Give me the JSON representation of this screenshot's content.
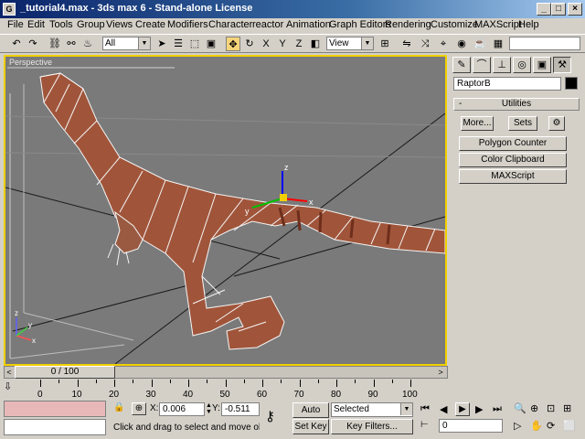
{
  "window": {
    "title": "_tutorial4.max - 3ds max 6 - Stand-alone License",
    "icon_label": "G",
    "controls": [
      "minimize-icon",
      "maximize-icon",
      "close-icon"
    ]
  },
  "menu": [
    "File",
    "Edit",
    "Tools",
    "Group",
    "Views",
    "Create",
    "Modifiers",
    "Character",
    "reactor",
    "Animation",
    "Graph Editors",
    "Rendering",
    "Customize",
    "MAXScript",
    "Help"
  ],
  "toolbar": {
    "selection_filter": "All",
    "reference_coord": "View",
    "axis_labels": [
      "X",
      "Y",
      "Z",
      "XY"
    ]
  },
  "viewport": {
    "label": "Perspective",
    "gizmo_axes": [
      "z",
      "x",
      "y"
    ],
    "background_color": "#7a7a7a",
    "active_border_color": "#f0d000",
    "mesh_color": "#a0553a"
  },
  "command_panel": {
    "object_name": "RaptorB",
    "object_color": "#000000",
    "rollout_title": "Utilities",
    "rollout_toggle": "-",
    "more_button": "More...",
    "sets_button": "Sets",
    "utilities": [
      "Polygon Counter",
      "Color Clipboard",
      "MAXScript"
    ]
  },
  "timeline": {
    "frame_display": "0 / 100",
    "prev_arrow": "<",
    "next_arrow": ">",
    "ruler_ticks": [
      "0",
      "10",
      "20",
      "30",
      "40",
      "50",
      "60",
      "70",
      "80",
      "90",
      "100"
    ]
  },
  "status": {
    "x_label": "X:",
    "x_value": "0.006",
    "y_label": "Y:",
    "y_value": "-0.511",
    "prompt": "Click and drag to select and move object",
    "auto_key_label": "Auto Key",
    "set_key_label": "Set Key",
    "key_mode": "Selected",
    "key_filters_label": "Key Filters...",
    "current_frame": "0"
  }
}
